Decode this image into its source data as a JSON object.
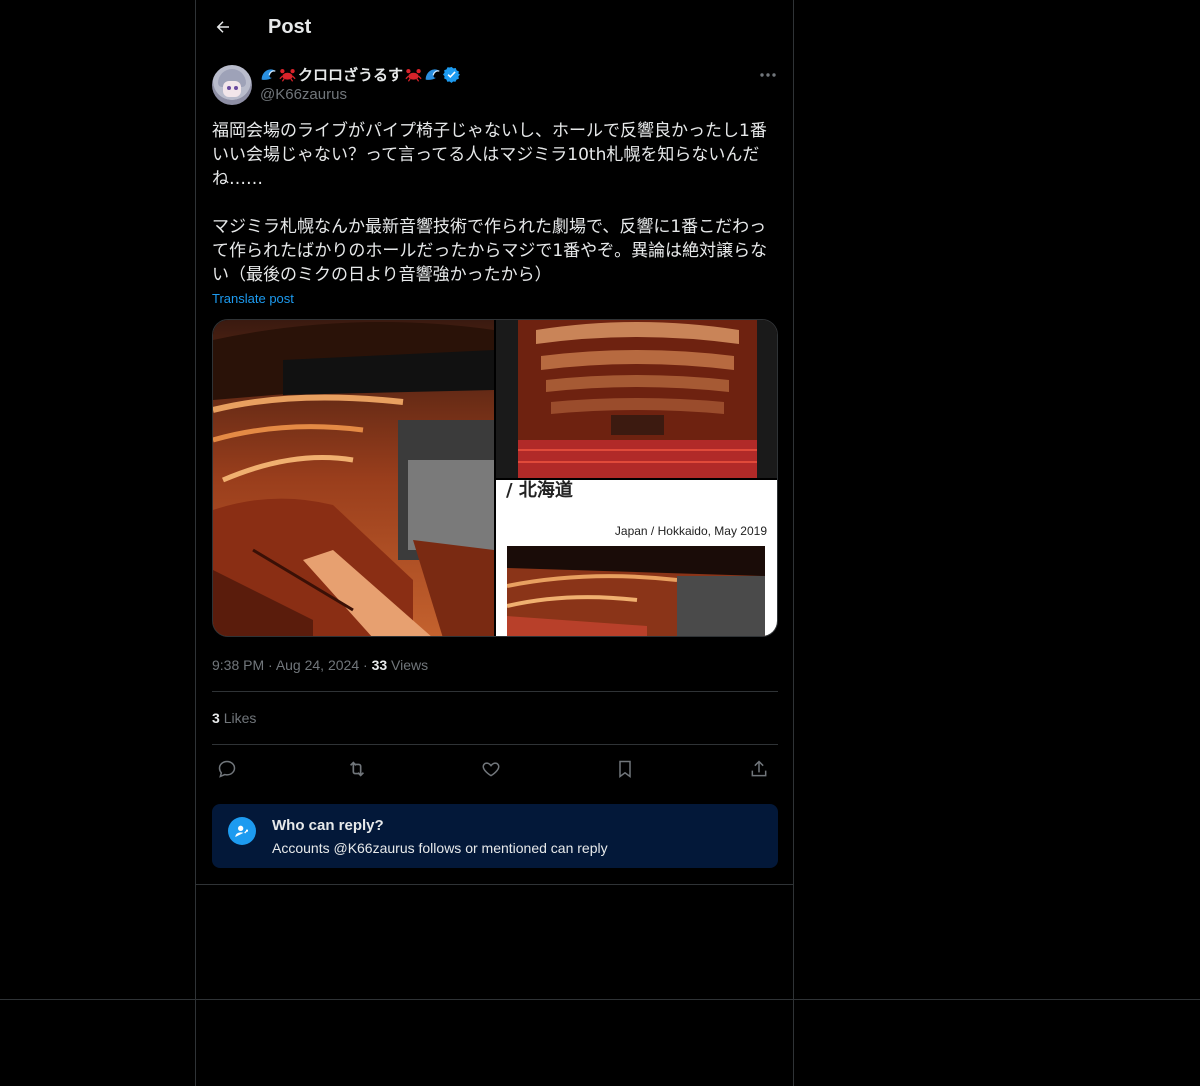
{
  "header": {
    "title": "Post"
  },
  "author": {
    "display_name": "クロロざうるす",
    "handle": "@K66zaurus",
    "emoji_left": [
      "wave-emoji",
      "crab-emoji"
    ],
    "emoji_right": [
      "crab-emoji",
      "wave-emoji"
    ],
    "verified": true
  },
  "post": {
    "text": "福岡会場のライブがパイプ椅子じゃないし、ホールで反響良かったし1番\nいい会場じゃない？って言ってる人はマジミラ10th札幌を知らないんだ\nね……\n\nマジミラ札幌なんか最新音響技術で作られた劇場で、反響に1番こだわっ\nて作られたばかりのホールだったからマジで1番やぞ。異論は絶対譲らな\nい（最後のミクの日より音響強かったから）",
    "translate_label": "Translate post",
    "media": {
      "image_c_heading": "/ 北海道",
      "image_c_caption": "Japan / Hokkaido, May 2019"
    },
    "time": "9:38 PM",
    "date": "Aug 24, 2024",
    "views_count": "33",
    "views_label": "Views",
    "likes_count": "3",
    "likes_label": "Likes"
  },
  "actions": [
    "reply-icon",
    "repost-icon",
    "like-icon",
    "bookmark-icon",
    "share-icon"
  ],
  "reply_restriction": {
    "title": "Who can reply?",
    "subtitle": "Accounts @K66zaurus follows or mentioned can reply"
  },
  "colors": {
    "background": "#000000",
    "accent": "#1d9bf0",
    "border": "#2f3336",
    "muted": "#71767b",
    "reply_box": "#031839"
  }
}
